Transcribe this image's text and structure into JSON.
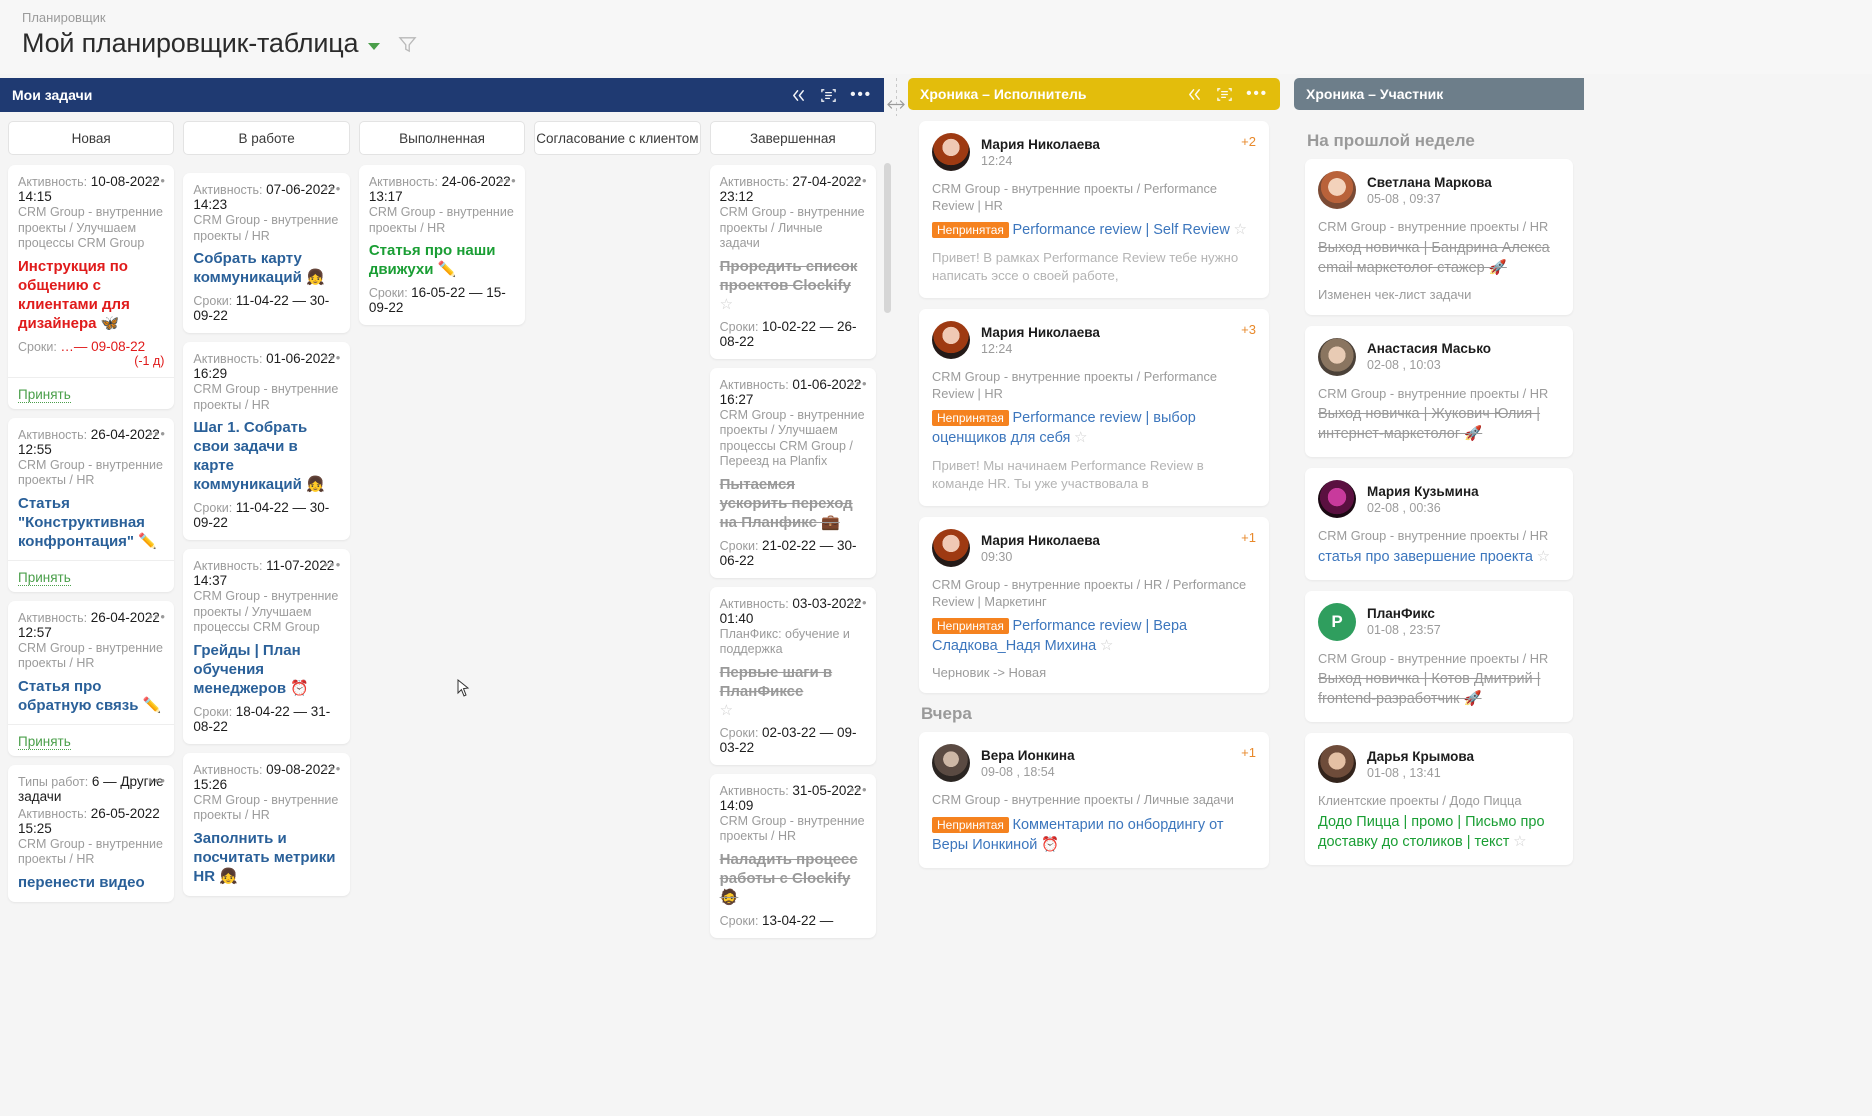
{
  "header": {
    "breadcrumb": "Планировщик",
    "title": "Мой планировщик-таблица",
    "caret_icon": "chevron-down-icon",
    "filter_icon": "funnel-icon"
  },
  "colors": {
    "mytasks_header": "#1f3a72",
    "chronicle_executor_header": "#e3bd0c",
    "chronicle_participant_header": "#6d7e8a",
    "badge": "#f5821f",
    "link": "#3c76bd",
    "overdue": "#e01b1b",
    "accept": "#4a9f4a"
  },
  "panels": {
    "mytasks": {
      "title": "Мои задачи",
      "tools": [
        "collapse-icon",
        "layout-icon",
        "more-icon"
      ],
      "tabs": [
        "Новая",
        "В работе",
        "Выполненная",
        "Согласование с клиентом",
        "Завершенная"
      ],
      "columns": [
        {
          "name": "Новая",
          "cards": [
            {
              "activity_label": "Активность:",
              "activity_date": "10-08-2022",
              "activity_time": "14:15",
              "path": "CRM Group - внутренние проекты / Улучшаем процессы CRM Group",
              "title": "Инструкция по общению с клиентами для дизайнера 🦋",
              "title_style": "red",
              "dates_label": "Сроки:",
              "dates": "…— 09-08-22",
              "dates_style": "overdue",
              "overdue": "(-1 д)",
              "accept": "Принять",
              "menu": "•••"
            },
            {
              "activity_label": "Активность:",
              "activity_date": "26-04-2022",
              "activity_time": "12:55",
              "path": "CRM Group - внутренние проекты / HR",
              "title": "Статья \"Конструктивная конфронтация\" ✏️",
              "title_style": "blue",
              "accept": "Принять",
              "menu": "•••"
            },
            {
              "activity_label": "Активность:",
              "activity_date": "26-04-2022",
              "activity_time": "12:57",
              "path": "CRM Group - внутренние проекты / HR",
              "title": "Статья про обратную связь ✏️",
              "title_style": "blue",
              "accept": "Принять",
              "menu": "•••"
            },
            {
              "worktype_label": "Типы работ:",
              "worktype": "6 — Другие задачи",
              "activity_label": "Активность:",
              "activity_date": "26-05-2022",
              "activity_time": "15:25",
              "path": "CRM Group - внутренние проекты / HR",
              "title": "перенести видео",
              "title_style": "blue",
              "menu": "•••"
            }
          ]
        },
        {
          "name": "В работе",
          "cards": [
            {
              "activity_label": "Активность:",
              "activity_date": "07-06-2022",
              "activity_time": "14:23",
              "path": "CRM Group - внутренние проекты / HR",
              "title": "Собрать карту коммуникаций 👧",
              "title_style": "blue",
              "dates_label": "Сроки:",
              "dates": "11-04-22 — 30-09-22",
              "menu": "•••"
            },
            {
              "activity_label": "Активность:",
              "activity_date": "01-06-2022",
              "activity_time": "16:29",
              "path": "CRM Group - внутренние проекты / HR",
              "title": "Шаг 1. Собрать свои задачи в карте коммуникаций 👧",
              "title_style": "blue",
              "dates_label": "Сроки:",
              "dates": "11-04-22 — 30-09-22",
              "menu": "•••"
            },
            {
              "activity_label": "Активность:",
              "activity_date": "11-07-2022",
              "activity_time": "14:37",
              "path": "CRM Group - внутренние проекты / Улучшаем процессы CRM Group",
              "title": "Грейды | План обучения менеджеров ⏰",
              "title_style": "blue",
              "dates_label": "Сроки:",
              "dates": "18-04-22 — 31-08-22",
              "menu": "•••"
            },
            {
              "activity_label": "Активность:",
              "activity_date": "09-08-2022",
              "activity_time": "15:26",
              "path": "CRM Group - внутренние проекты / HR",
              "title": "Заполнить и посчитать метрики HR 👧",
              "title_style": "blue",
              "menu": "•••"
            }
          ]
        },
        {
          "name": "Выполненная",
          "cards": [
            {
              "activity_label": "Активность:",
              "activity_date": "24-06-2022",
              "activity_time": "13:17",
              "path": "CRM Group - внутренние проекты / HR",
              "title": "Статья про наши движухи ✏️",
              "title_style": "green",
              "dates_label": "Сроки:",
              "dates": "16-05-22 — 15-09-22",
              "menu": "•••"
            }
          ]
        },
        {
          "name": "Согласование с клиентом",
          "cards": []
        },
        {
          "name": "Завершенная",
          "cards": [
            {
              "activity_label": "Активность:",
              "activity_date": "27-04-2022",
              "activity_time": "23:12",
              "path": "CRM Group - внутренние проекты / Личные задачи",
              "title": "Проредить список проектов Clockify",
              "title_style": "done",
              "star": "☆",
              "dates_label": "Сроки:",
              "dates": "10-02-22 — 26-08-22",
              "menu": "•••"
            },
            {
              "activity_label": "Активность:",
              "activity_date": "01-06-2022",
              "activity_time": "16:27",
              "path": "CRM Group - внутренние проекты / Улучшаем процессы CRM Group / Переезд на Planfix",
              "title": "Пытаемся ускорить переход на Планфикс 💼",
              "title_style": "done",
              "dates_label": "Сроки:",
              "dates": "21-02-22 — 30-06-22",
              "menu": "•••"
            },
            {
              "activity_label": "Активность:",
              "activity_date": "03-03-2022",
              "activity_time": "01:40",
              "path": "ПланФикс: обучение и поддержка",
              "title": "Первые шаги в ПланФиксе",
              "title_style": "done",
              "star": "☆",
              "dates_label": "Сроки:",
              "dates": "02-03-22 — 09-03-22",
              "menu": "•••"
            },
            {
              "activity_label": "Активность:",
              "activity_date": "31-05-2022",
              "activity_time": "14:09",
              "path": "CRM Group - внутренние проекты / HR",
              "title": "Наладить процесс работы с Clockify 🧔",
              "title_style": "done",
              "dates_label": "Сроки:",
              "dates": "13-04-22 —",
              "menu": "•••"
            }
          ]
        }
      ]
    },
    "chronicle_executor": {
      "title": "Хроника – Исполнитель",
      "tools": [
        "collapse-icon",
        "layout-icon",
        "more-icon"
      ],
      "groups": [
        {
          "label": "",
          "items": [
            {
              "user": "Мария Николаева",
              "time": "12:24",
              "plus": "+2",
              "path": "CRM Group - внутренние проекты / Performance Review | HR",
              "badge": "Непринятая",
              "link": "Performance review | Self Review",
              "star": "☆",
              "desc": "Привет! В рамках Performance Review тебе нужно написать эссе о своей работе,"
            },
            {
              "user": "Мария Николаева",
              "time": "12:24",
              "plus": "+3",
              "path": "CRM Group - внутренние проекты / Performance Review | HR",
              "badge": "Непринятая",
              "link": "Performance review | выбор оценщиков для себя",
              "star": "☆",
              "desc": "Привет! Мы начинаем Performance Review в команде HR. Ты уже участвовала в"
            },
            {
              "user": "Мария Николаева",
              "time": "09:30",
              "plus": "+1",
              "path": "CRM Group - внутренние проекты / HR / Performance Review | Маркетинг",
              "badge": "Непринятая",
              "link": "Performance review | Вера Сладкова_Надя Михина",
              "star": "☆",
              "note": "Черновик -> Новая"
            }
          ]
        },
        {
          "label": "Вчера",
          "items": [
            {
              "user": "Вера Ионкина",
              "time": "09-08 , 18:54",
              "plus": "+1",
              "path": "CRM Group - внутренние проекты / Личные задачи",
              "badge": "Непринятая",
              "link": "Комментарии по онбордингу от Веры Ионкиной ⏰"
            }
          ]
        }
      ]
    },
    "chronicle_participant": {
      "title": "Хроника – Участник",
      "groups": [
        {
          "label": "На прошлой неделе",
          "items": [
            {
              "user": "Светлана Маркова",
              "time": "05-08 , 09:37",
              "path": "CRM Group - внутренние проекты / HR",
              "link": "Выход новичка | Бандрина Алекса email маркетолог стажер 🚀",
              "link_style": "done",
              "note": "Изменен чек-лист задачи"
            },
            {
              "user": "Анастасия Масько",
              "time": "02-08 , 10:03",
              "path": "CRM Group - внутренние проекты / HR",
              "link": "Выход новичка | Жукович Юлия | интернет-маркетолог 🚀",
              "link_style": "done"
            },
            {
              "user": "Мария Кузьмина",
              "time": "02-08 , 00:36",
              "path": "CRM Group - внутренние проекты / HR",
              "link": "статья про завершение проекта",
              "link_style": "blue",
              "star": "☆"
            },
            {
              "user": "ПланФикс",
              "time": "01-08 , 23:57",
              "path": "CRM Group - внутренние проекты / HR",
              "link": "Выход новичка | Котов Дмитрий | frontend-разработчик 🚀",
              "link_style": "done"
            },
            {
              "user": "Дарья Крымова",
              "time": "01-08 , 13:41",
              "path": "Клиентские проекты / Додо Пицца",
              "link": "Додо Пицца | промо | Письмо про доставку до столиков | текст",
              "link_style": "green",
              "star": "☆"
            }
          ]
        }
      ]
    }
  }
}
